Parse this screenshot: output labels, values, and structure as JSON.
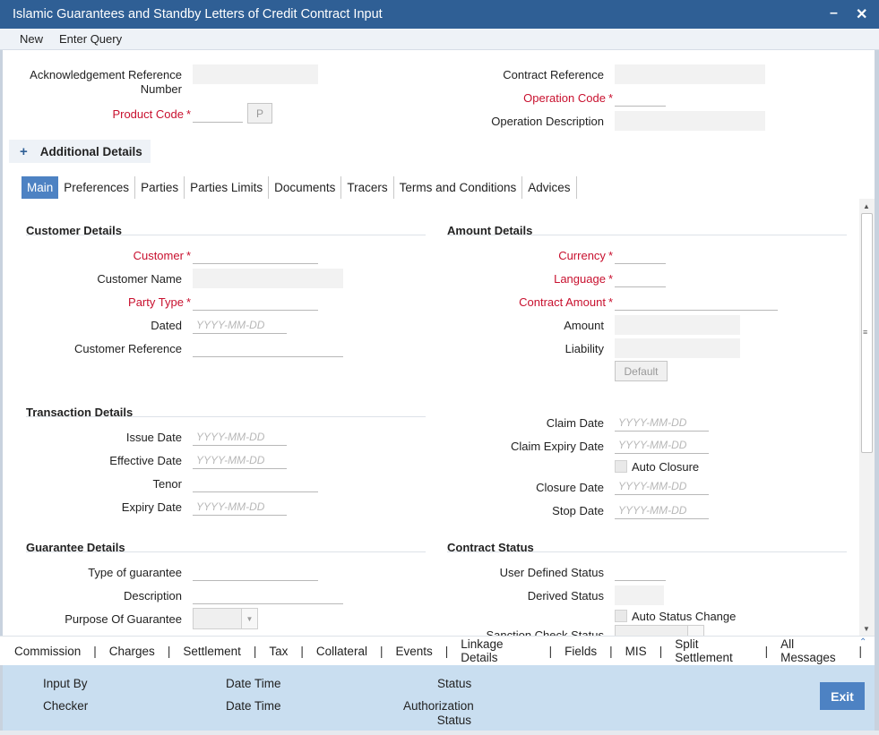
{
  "window": {
    "title": "Islamic Guarantees and Standby Letters of Credit Contract Input"
  },
  "menu": {
    "new": "New",
    "enter_query": "Enter Query"
  },
  "header": {
    "ack_ref_label_1": "Acknowledgement Reference",
    "ack_ref_label_2": "Number",
    "product_code_label": "Product Code",
    "product_button": "P",
    "contract_ref_label": "Contract Reference",
    "operation_code_label": "Operation Code",
    "operation_desc_label": "Operation Description",
    "required_star": "*"
  },
  "additional_details": {
    "plus": "+",
    "label": "Additional Details"
  },
  "tabs": [
    {
      "label": "Main",
      "active": true
    },
    {
      "label": "Preferences"
    },
    {
      "label": "Parties"
    },
    {
      "label": "Parties Limits"
    },
    {
      "label": "Documents"
    },
    {
      "label": "Tracers"
    },
    {
      "label": "Terms and Conditions"
    },
    {
      "label": "Advices"
    }
  ],
  "customer_details": {
    "title": "Customer Details",
    "customer": "Customer",
    "customer_name": "Customer Name",
    "party_type": "Party Type",
    "dated": "Dated",
    "customer_reference": "Customer Reference"
  },
  "amount_details": {
    "title": "Amount Details",
    "currency": "Currency",
    "language": "Language",
    "contract_amount": "Contract Amount",
    "amount": "Amount",
    "liability": "Liability",
    "default_button": "Default"
  },
  "transaction_details": {
    "title": "Transaction Details",
    "issue_date": "Issue Date",
    "effective_date": "Effective Date",
    "tenor": "Tenor",
    "expiry_date": "Expiry Date",
    "claim_date": "Claim Date",
    "claim_expiry_date": "Claim Expiry Date",
    "auto_closure": "Auto Closure",
    "closure_date": "Closure Date",
    "stop_date": "Stop Date"
  },
  "guarantee_details": {
    "title": "Guarantee Details",
    "type_of_guarantee": "Type of guarantee",
    "description": "Description",
    "purpose_of_guarantee": "Purpose Of Guarantee"
  },
  "contract_status": {
    "title": "Contract Status",
    "user_defined_status": "User Defined Status",
    "derived_status": "Derived Status",
    "auto_status_change": "Auto Status Change",
    "sanction_check_status": "Sanction Check Status"
  },
  "date_placeholder": "YYYY-MM-DD",
  "bottom_tabs": [
    "Commission",
    "Charges",
    "Settlement",
    "Tax",
    "Collateral",
    "Events",
    "Linkage Details",
    "Fields",
    "MIS",
    "Split Settlement",
    "All Messages"
  ],
  "bottom_sep": "|",
  "footer": {
    "input_by": "Input By",
    "checker": "Checker",
    "date_time": "Date Time",
    "status": "Status",
    "authorization_1": "Authorization",
    "authorization_2": "Status",
    "exit": "Exit"
  }
}
